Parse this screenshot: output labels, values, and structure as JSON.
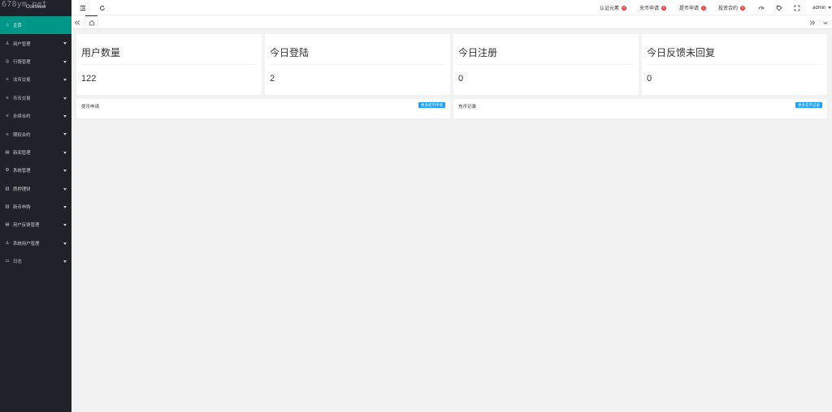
{
  "watermark": "678ym.net",
  "logo": "Coinwow",
  "sidebar": {
    "items": [
      {
        "label": "主页",
        "icon": "home-icon",
        "glyph": "⌂",
        "active": true,
        "arrow": false
      },
      {
        "label": "用户管理",
        "icon": "user-icon",
        "glyph": "♙",
        "active": false,
        "arrow": true
      },
      {
        "label": "行情管理",
        "icon": "chart-icon",
        "glyph": "◎",
        "active": false,
        "arrow": true
      },
      {
        "label": "法币交易",
        "icon": "list-icon",
        "glyph": "≡",
        "active": false,
        "arrow": true
      },
      {
        "label": "币币交易",
        "icon": "list-icon",
        "glyph": "≡",
        "active": false,
        "arrow": true
      },
      {
        "label": "永续合约",
        "icon": "list-icon",
        "glyph": "≡",
        "active": false,
        "arrow": true
      },
      {
        "label": "期权合约",
        "icon": "list-icon",
        "glyph": "≡",
        "active": false,
        "arrow": true
      },
      {
        "label": "新闻管理",
        "icon": "news-icon",
        "glyph": "▤",
        "active": false,
        "arrow": true
      },
      {
        "label": "系统管理",
        "icon": "gear-icon",
        "glyph": "⚙",
        "active": false,
        "arrow": true
      },
      {
        "label": "质押理财",
        "icon": "finance-icon",
        "glyph": "▥",
        "active": false,
        "arrow": true
      },
      {
        "label": "新币申购",
        "icon": "coin-icon",
        "glyph": "▥",
        "active": false,
        "arrow": true
      },
      {
        "label": "用户反馈管理",
        "icon": "feedback-icon",
        "glyph": "▤",
        "active": false,
        "arrow": true
      },
      {
        "label": "系统用户管理",
        "icon": "admin-user-icon",
        "glyph": "♙",
        "active": false,
        "arrow": true
      },
      {
        "label": "日志",
        "icon": "log-icon",
        "glyph": "▭",
        "active": false,
        "arrow": true
      }
    ]
  },
  "header": {
    "notifications": [
      {
        "label": "认证元素",
        "count": "0"
      },
      {
        "label": "充币申请",
        "count": "0"
      },
      {
        "label": "提币申请",
        "count": "1"
      },
      {
        "label": "投资合约",
        "count": "0"
      }
    ],
    "user": "admin"
  },
  "stats": [
    {
      "title": "用户数量",
      "value": "122"
    },
    {
      "title": "今日登陆",
      "value": "2"
    },
    {
      "title": "今日注册",
      "value": "0"
    },
    {
      "title": "今日反馈未回复",
      "value": "0"
    }
  ],
  "panels": [
    {
      "title": "提币申请",
      "button": "更多提币申请"
    },
    {
      "title": "充币记录",
      "button": "更多充币记录"
    }
  ],
  "colors": {
    "sidebar_bg": "#20222a",
    "active": "#009688",
    "badge": "#ff3333",
    "button": "#1e9fff"
  }
}
